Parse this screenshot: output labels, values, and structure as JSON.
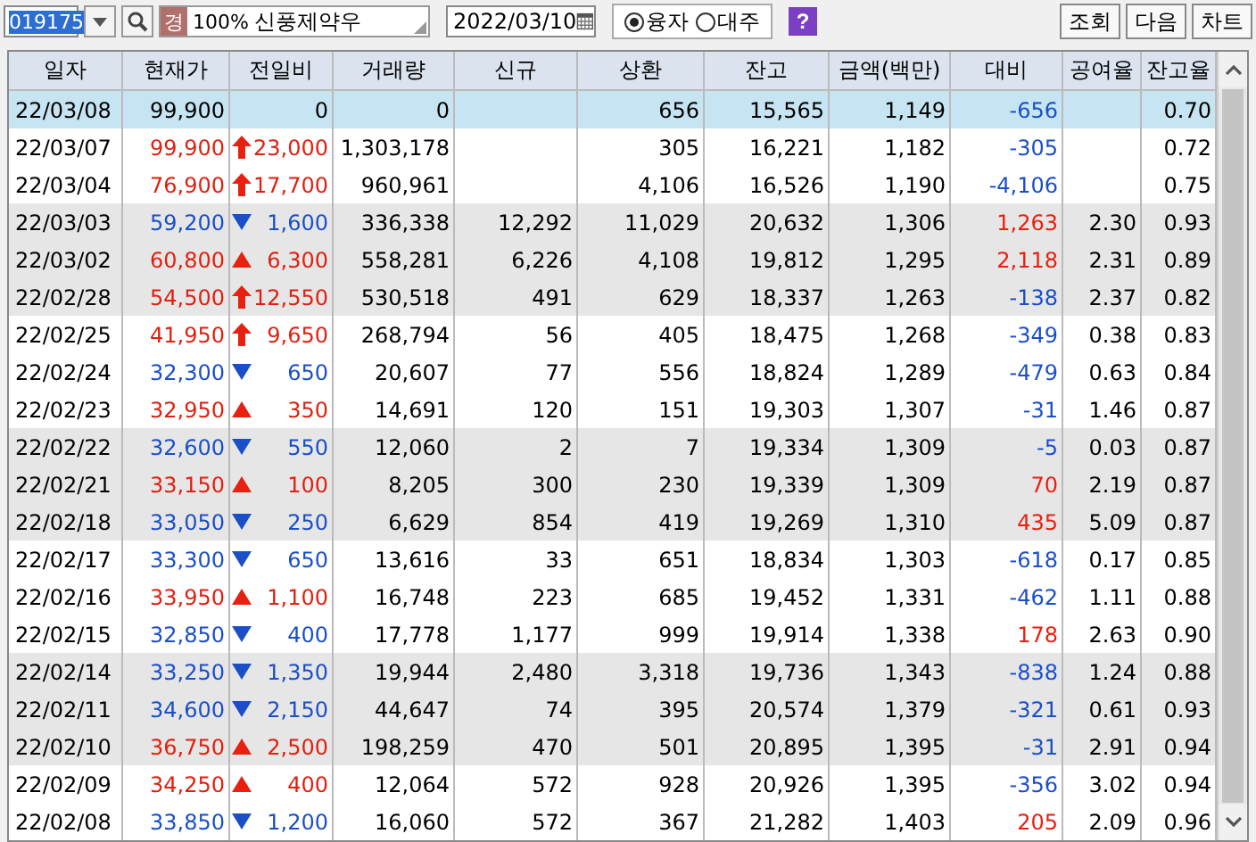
{
  "toolbar": {
    "code": "019175",
    "badge": "경",
    "ratio": "100%",
    "name": "신풍제약우",
    "date": "2022/03/10",
    "radios": [
      {
        "label": "융자",
        "selected": true
      },
      {
        "label": "대주",
        "selected": false
      }
    ],
    "help": "?",
    "buttons": [
      "조회",
      "다음",
      "차트"
    ]
  },
  "table": {
    "columns": [
      "일자",
      "현재가",
      "전일비",
      "거래량",
      "신규",
      "상환",
      "잔고",
      "금액(백만)",
      "대비",
      "공여율",
      "잔고율"
    ],
    "rows": [
      {
        "selected": true,
        "kind": "flat",
        "date": "22/03/08",
        "price": "99,900",
        "change": "0",
        "volume": "0",
        "repay": "656",
        "balance": "15,565",
        "amount": "1,149",
        "diff": {
          "text": "-656",
          "color": "#1a4fc8"
        },
        "balance_ratio": "0.70"
      },
      {
        "selected": false,
        "shaded": false,
        "kind": "limit",
        "date": "22/03/07",
        "price": "99,900",
        "change": "23,000",
        "volume": "1,303,178",
        "repay": "305",
        "balance": "16,221",
        "amount": "1,182",
        "diff": {
          "text": "-305",
          "color": "#1a4fc8"
        },
        "balance_ratio": "0.72"
      },
      {
        "selected": false,
        "shaded": false,
        "kind": "limit",
        "date": "22/03/04",
        "price": "76,900",
        "change": "17,700",
        "volume": "960,961",
        "repay": "4,106",
        "balance": "16,526",
        "amount": "1,190",
        "diff": {
          "text": "-4,106",
          "color": "#1a4fc8"
        },
        "balance_ratio": "0.75"
      },
      {
        "selected": false,
        "shaded": true,
        "kind": "fall",
        "date": "22/03/03",
        "price": "59,200",
        "change": "1,600",
        "volume": "336,338",
        "new": "12,292",
        "repay": "11,029",
        "balance": "20,632",
        "amount": "1,306",
        "diff": {
          "text": "1,263",
          "color": "#e82010"
        },
        "short_ratio": "2.30",
        "balance_ratio": "0.93"
      },
      {
        "selected": false,
        "shaded": true,
        "kind": "rise",
        "date": "22/03/02",
        "price": "60,800",
        "change": "6,300",
        "volume": "558,281",
        "new": "6,226",
        "repay": "4,108",
        "balance": "19,812",
        "amount": "1,295",
        "diff": {
          "text": "2,118",
          "color": "#e82010"
        },
        "short_ratio": "2.31",
        "balance_ratio": "0.89"
      },
      {
        "selected": false,
        "shaded": true,
        "kind": "limit",
        "date": "22/02/28",
        "price": "54,500",
        "change": "12,550",
        "volume": "530,518",
        "new": "491",
        "repay": "629",
        "balance": "18,337",
        "amount": "1,263",
        "diff": {
          "text": "-138",
          "color": "#1a4fc8"
        },
        "short_ratio": "2.37",
        "balance_ratio": "0.82"
      },
      {
        "selected": false,
        "shaded": false,
        "kind": "limit",
        "date": "22/02/25",
        "price": "41,950",
        "change": "9,650",
        "volume": "268,794",
        "new": "56",
        "repay": "405",
        "balance": "18,475",
        "amount": "1,268",
        "diff": {
          "text": "-349",
          "color": "#1a4fc8"
        },
        "short_ratio": "0.38",
        "balance_ratio": "0.83"
      },
      {
        "selected": false,
        "shaded": false,
        "kind": "fall",
        "date": "22/02/24",
        "price": "32,300",
        "change": "650",
        "volume": "20,607",
        "new": "77",
        "repay": "556",
        "balance": "18,824",
        "amount": "1,289",
        "diff": {
          "text": "-479",
          "color": "#1a4fc8"
        },
        "short_ratio": "0.63",
        "balance_ratio": "0.84"
      },
      {
        "selected": false,
        "shaded": false,
        "kind": "rise",
        "date": "22/02/23",
        "price": "32,950",
        "change": "350",
        "volume": "14,691",
        "new": "120",
        "repay": "151",
        "balance": "19,303",
        "amount": "1,307",
        "diff": {
          "text": "-31",
          "color": "#1a4fc8"
        },
        "short_ratio": "1.46",
        "balance_ratio": "0.87"
      },
      {
        "selected": false,
        "shaded": true,
        "kind": "fall",
        "date": "22/02/22",
        "price": "32,600",
        "change": "550",
        "volume": "12,060",
        "new": "2",
        "repay": "7",
        "balance": "19,334",
        "amount": "1,309",
        "diff": {
          "text": "-5",
          "color": "#1a4fc8"
        },
        "short_ratio": "0.03",
        "balance_ratio": "0.87"
      },
      {
        "selected": false,
        "shaded": true,
        "kind": "rise",
        "date": "22/02/21",
        "price": "33,150",
        "change": "100",
        "volume": "8,205",
        "new": "300",
        "repay": "230",
        "balance": "19,339",
        "amount": "1,309",
        "diff": {
          "text": "70",
          "color": "#e82010"
        },
        "short_ratio": "2.19",
        "balance_ratio": "0.87"
      },
      {
        "selected": false,
        "shaded": true,
        "kind": "fall",
        "date": "22/02/18",
        "price": "33,050",
        "change": "250",
        "volume": "6,629",
        "new": "854",
        "repay": "419",
        "balance": "19,269",
        "amount": "1,310",
        "diff": {
          "text": "435",
          "color": "#e82010"
        },
        "short_ratio": "5.09",
        "balance_ratio": "0.87"
      },
      {
        "selected": false,
        "shaded": false,
        "kind": "fall",
        "date": "22/02/17",
        "price": "33,300",
        "change": "650",
        "volume": "13,616",
        "new": "33",
        "repay": "651",
        "balance": "18,834",
        "amount": "1,303",
        "diff": {
          "text": "-618",
          "color": "#1a4fc8"
        },
        "short_ratio": "0.17",
        "balance_ratio": "0.85"
      },
      {
        "selected": false,
        "shaded": false,
        "kind": "rise",
        "date": "22/02/16",
        "price": "33,950",
        "change": "1,100",
        "volume": "16,748",
        "new": "223",
        "repay": "685",
        "balance": "19,452",
        "amount": "1,331",
        "diff": {
          "text": "-462",
          "color": "#1a4fc8"
        },
        "short_ratio": "1.11",
        "balance_ratio": "0.88"
      },
      {
        "selected": false,
        "shaded": false,
        "kind": "fall",
        "date": "22/02/15",
        "price": "32,850",
        "change": "400",
        "volume": "17,778",
        "new": "1,177",
        "repay": "999",
        "balance": "19,914",
        "amount": "1,338",
        "diff": {
          "text": "178",
          "color": "#e82010"
        },
        "short_ratio": "2.63",
        "balance_ratio": "0.90"
      },
      {
        "selected": false,
        "shaded": true,
        "kind": "fall",
        "date": "22/02/14",
        "price": "33,250",
        "change": "1,350",
        "volume": "19,944",
        "new": "2,480",
        "repay": "3,318",
        "balance": "19,736",
        "amount": "1,343",
        "diff": {
          "text": "-838",
          "color": "#1a4fc8"
        },
        "short_ratio": "1.24",
        "balance_ratio": "0.88"
      },
      {
        "selected": false,
        "shaded": true,
        "kind": "fall",
        "date": "22/02/11",
        "price": "34,600",
        "change": "2,150",
        "volume": "44,647",
        "new": "74",
        "repay": "395",
        "balance": "20,574",
        "amount": "1,379",
        "diff": {
          "text": "-321",
          "color": "#1a4fc8"
        },
        "short_ratio": "0.61",
        "balance_ratio": "0.93"
      },
      {
        "selected": false,
        "shaded": true,
        "kind": "rise",
        "date": "22/02/10",
        "price": "36,750",
        "change": "2,500",
        "volume": "198,259",
        "new": "470",
        "repay": "501",
        "balance": "20,895",
        "amount": "1,395",
        "diff": {
          "text": "-31",
          "color": "#1a4fc8"
        },
        "short_ratio": "2.91",
        "balance_ratio": "0.94"
      },
      {
        "selected": false,
        "shaded": false,
        "kind": "rise",
        "date": "22/02/09",
        "price": "34,250",
        "change": "400",
        "volume": "12,064",
        "new": "572",
        "repay": "928",
        "balance": "20,926",
        "amount": "1,395",
        "diff": {
          "text": "-356",
          "color": "#1a4fc8"
        },
        "short_ratio": "3.02",
        "balance_ratio": "0.94"
      },
      {
        "selected": false,
        "shaded": false,
        "kind": "fall",
        "date": "22/02/08",
        "price": "33,850",
        "change": "1,200",
        "volume": "16,060",
        "new": "572",
        "repay": "367",
        "balance": "21,282",
        "amount": "1,403",
        "diff": {
          "text": "205",
          "color": "#e82010"
        },
        "short_ratio": "2.09",
        "balance_ratio": "0.96"
      }
    ]
  }
}
